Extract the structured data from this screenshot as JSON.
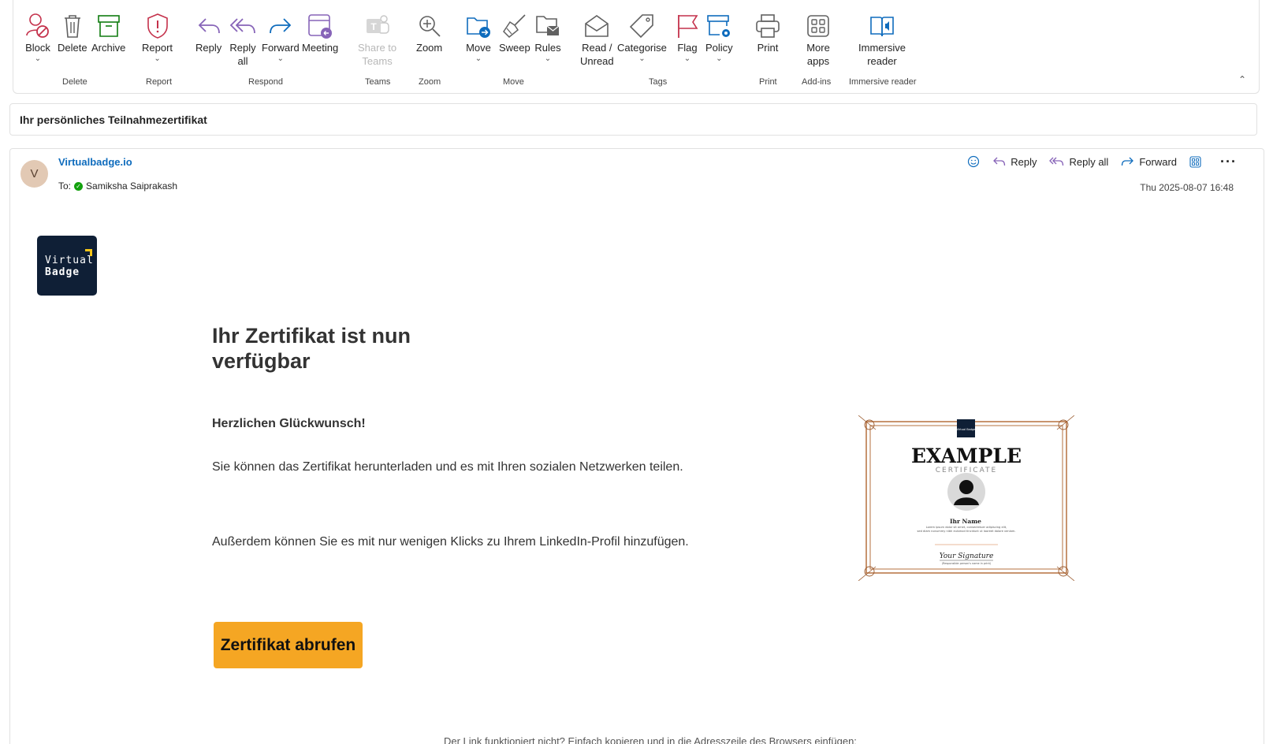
{
  "ribbon": {
    "buttons": {
      "block": "Block",
      "delete": "Delete",
      "archive": "Archive",
      "report": "Report",
      "reply": "Reply",
      "reply_all_1": "Reply",
      "reply_all_2": "all",
      "forward": "Forward",
      "meeting": "Meeting",
      "share_1": "Share to",
      "share_2": "Teams",
      "zoom": "Zoom",
      "move": "Move",
      "sweep": "Sweep",
      "rules": "Rules",
      "read_1": "Read /",
      "read_2": "Unread",
      "categorise": "Categorise",
      "flag": "Flag",
      "policy": "Policy",
      "print": "Print",
      "more_1": "More",
      "more_2": "apps",
      "immersive_1": "Immersive",
      "immersive_2": "reader"
    },
    "groups": {
      "delete": "Delete",
      "report": "Report",
      "respond": "Respond",
      "teams": "Teams",
      "zoom": "Zoom",
      "move": "Move",
      "tags": "Tags",
      "print": "Print",
      "addins": "Add-ins",
      "immersive": "Immersive reader"
    },
    "colors": {
      "red": "#c4314b",
      "purple": "#8764b8",
      "blue": "#0f6cbd",
      "green": "#107c10",
      "grey": "#616161"
    }
  },
  "subject": "Ihr persönliches Teilnahmezertifikat",
  "message": {
    "avatar_initial": "V",
    "sender": "Virtualbadge.io",
    "to_label": "To:",
    "recipient": "Samiksha Saiprakash",
    "actions": {
      "reply": "Reply",
      "reply_all": "Reply all",
      "forward": "Forward"
    },
    "date": "Thu 2025-08-07 16:48"
  },
  "body": {
    "logo": {
      "line1": "Virtual",
      "line2": "Badge"
    },
    "headline": "Ihr Zertifikat ist nun verfügbar",
    "congrats": "Herzlichen Glückwunsch!",
    "para1": "Sie können das Zertifikat herunterladen und es mit Ihren sozialen Netzwerken teilen.",
    "para2": "Außerdem können Sie es mit nur wenigen Klicks zu Ihrem LinkedIn-Profil hinzufügen.",
    "cta": "Zertifikat abrufen",
    "footer_note": "Der Link funktioniert nicht? Einfach kopieren und in die Adresszeile des Browsers einfügen:",
    "cta_color": "#f5a623"
  },
  "certificate": {
    "title": "EXAMPLE",
    "subtitle": "CERTIFICATE",
    "name": "Ihr Name",
    "lorem1": "Lorem ipsum dolor sit amet, consectetuer adipiscing elit,",
    "lorem2": "sed diam nonummy nibh euismod tincidunt ut laoreet dolore veniam.",
    "signature": "Your Signature",
    "signature_caption": "(Responsible person's name in print)",
    "logo_text": "Virtual Badge"
  }
}
